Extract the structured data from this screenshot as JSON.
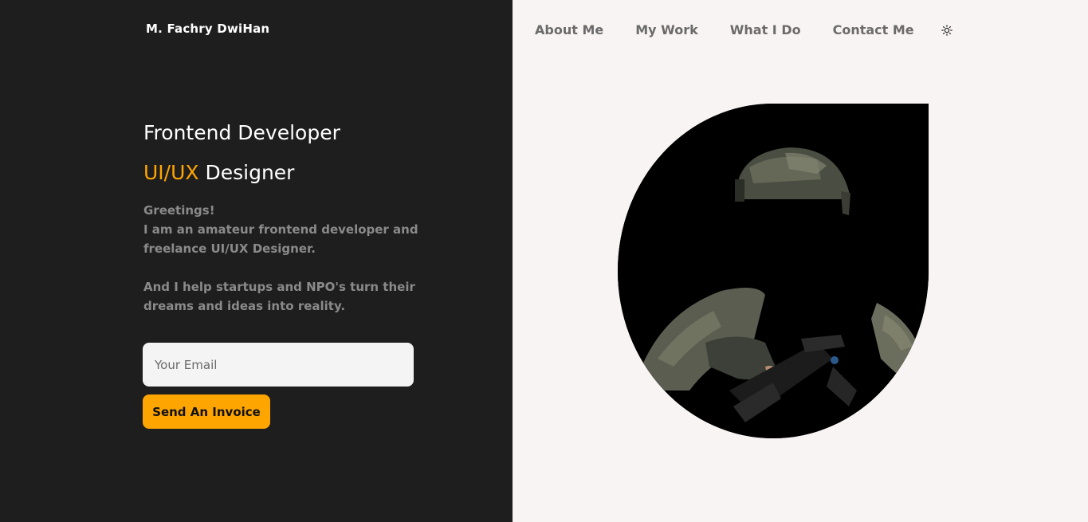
{
  "brand": {
    "name": "M. Fachry DwiHan"
  },
  "hero": {
    "title": "Frontend Developer",
    "subtitle_accent": "UI/UX",
    "subtitle_rest": "Designer",
    "greeting": "Greetings!",
    "intro": "I am an amateur frontend developer and freelance UI/UX Designer.",
    "mission": "And I help startups and NPO's turn their dreams and ideas into reality."
  },
  "form": {
    "email_placeholder": "Your Email",
    "submit_label": "Send An Invoice"
  },
  "nav": {
    "items": [
      {
        "label": "About Me"
      },
      {
        "label": "My Work"
      },
      {
        "label": "What I Do"
      },
      {
        "label": "Contact Me"
      }
    ],
    "theme_icon": "sun-icon"
  },
  "colors": {
    "left_bg": "#1e1e1e",
    "right_bg": "#f8f4f3",
    "accent": "#ffa500"
  }
}
